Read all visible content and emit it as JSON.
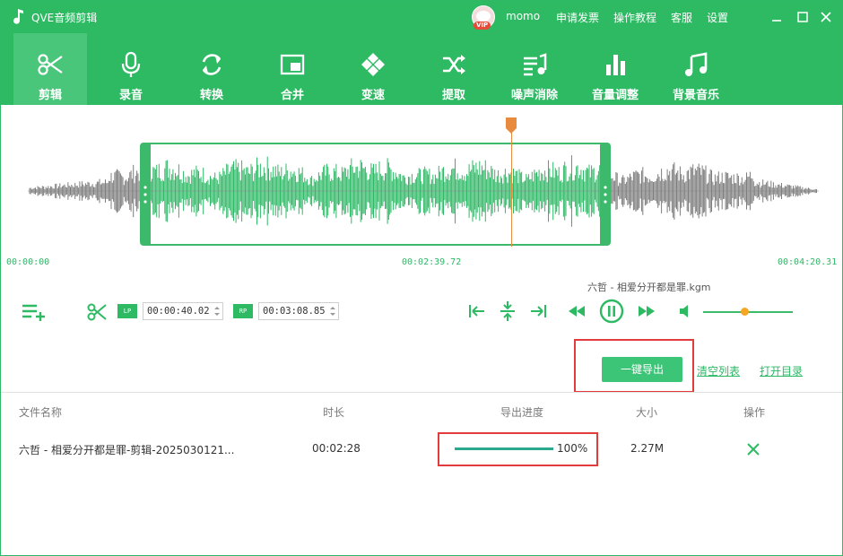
{
  "titlebar": {
    "app_title": "QVE音频剪辑",
    "username": "momo",
    "vip_label": "VIP",
    "links": [
      "申请发票",
      "操作教程",
      "客服",
      "设置"
    ]
  },
  "tabs": [
    {
      "label": "剪辑",
      "icon": "scissors-icon",
      "active": true
    },
    {
      "label": "录音",
      "icon": "microphone-icon",
      "active": false
    },
    {
      "label": "转换",
      "icon": "convert-icon",
      "active": false
    },
    {
      "label": "合并",
      "icon": "merge-icon",
      "active": false
    },
    {
      "label": "变速",
      "icon": "speed-icon",
      "active": false
    },
    {
      "label": "提取",
      "icon": "shuffle-icon",
      "active": false
    },
    {
      "label": "噪声消除",
      "icon": "noise-reduction-icon",
      "active": false
    },
    {
      "label": "音量调整",
      "icon": "volume-bars-icon",
      "active": false
    },
    {
      "label": "背景音乐",
      "icon": "music-note-icon",
      "active": false
    }
  ],
  "waveform": {
    "start_time": "00:00:00",
    "playhead_time": "00:02:39.72",
    "end_time": "00:04:20.31"
  },
  "controls": {
    "lp_label": "LP",
    "lp_time": "00:00:40.02",
    "rp_label": "RP",
    "rp_time": "00:03:08.85",
    "now_playing": "六哲 - 相爱分开都是罪.kgm",
    "volume_level": 0.46
  },
  "actions": {
    "export": "一键导出",
    "clear_list": "清空列表",
    "open_dir": "打开目录"
  },
  "table": {
    "headers": {
      "name": "文件名称",
      "duration": "时长",
      "progress": "导出进度",
      "size": "大小",
      "ops": "操作"
    },
    "rows": [
      {
        "name": "六哲 - 相爱分开都是罪-剪辑-2025030121...",
        "duration": "00:02:28",
        "progress_label": "100%",
        "progress": 1.0,
        "size": "2.27M"
      }
    ]
  },
  "colors": {
    "brand": "#2dba63",
    "accent": "#3cc477",
    "highlight": "#e23b3b",
    "playhead": "#e98b3f",
    "wave_selected": "#2fb866",
    "wave_unselected": "#7d7d7d"
  }
}
